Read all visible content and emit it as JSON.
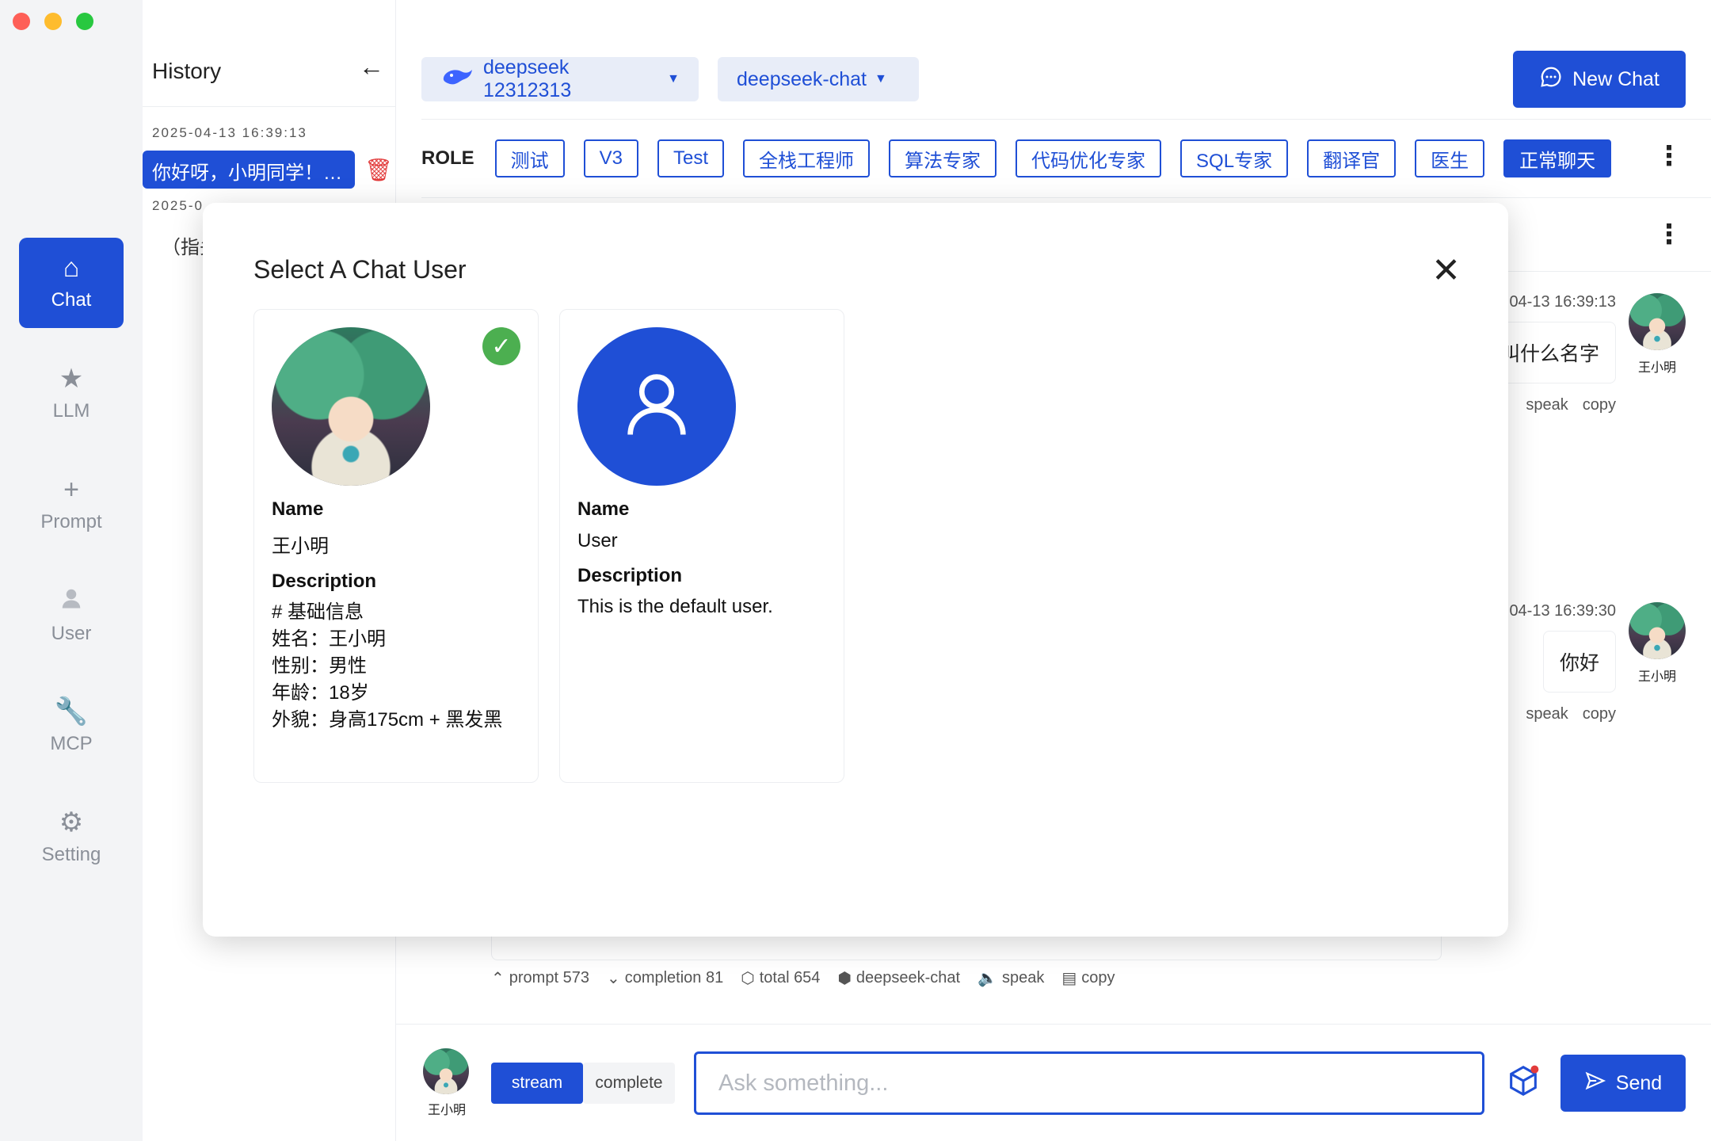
{
  "nav": {
    "items": [
      {
        "label": "Chat",
        "icon": "home-icon",
        "active": true
      },
      {
        "label": "LLM",
        "icon": "star-icon",
        "active": false
      },
      {
        "label": "Prompt",
        "icon": "plus-icon",
        "active": false
      },
      {
        "label": "User",
        "icon": "user-icon",
        "active": false
      },
      {
        "label": "MCP",
        "icon": "wrench-icon",
        "active": false
      },
      {
        "label": "Setting",
        "icon": "gear-icon",
        "active": false
      }
    ]
  },
  "history": {
    "title": "History",
    "entries": [
      {
        "timestamp": "2025-04-13 16:39:13",
        "text": "你好呀，小明同学！…"
      },
      {
        "timestamp": "2025-0",
        "text": "（指头"
      }
    ]
  },
  "topbar": {
    "provider": "deepseek 12312313",
    "model": "deepseek-chat",
    "new_chat": "New Chat"
  },
  "roles": {
    "label": "ROLE",
    "items": [
      "测试",
      "V3",
      "Test",
      "全栈工程师",
      "算法专家",
      "代码优化专家",
      "SQL专家",
      "翻译官",
      "医生",
      "正常聊天"
    ],
    "active": "正常聊天"
  },
  "messages": [
    {
      "meta": "04-13 16:39:13",
      "text": "叫什么名字",
      "user": "王小明",
      "actions": [
        "speak",
        "copy"
      ]
    },
    {
      "meta": "04-13 16:39:30",
      "text": "你好",
      "user": "王小明",
      "actions": [
        "speak",
        "copy"
      ]
    }
  ],
  "usage": {
    "prompt": "prompt 573",
    "completion": "completion 81",
    "total": "total 654",
    "model": "deepseek-chat",
    "speak": "speak",
    "copy": "copy"
  },
  "composer": {
    "user_name": "王小明",
    "mode_stream": "stream",
    "mode_complete": "complete",
    "placeholder": "Ask something...",
    "send": "Send"
  },
  "modal": {
    "title": "Select A Chat User",
    "users": [
      {
        "name_label": "Name",
        "name": "王小明",
        "desc_label": "Description",
        "description": "# 基础信息\n姓名：王小明\n性别：男性\n年龄：18岁\n外貌：身高175cm + 黑发黑",
        "selected": true
      },
      {
        "name_label": "Name",
        "name": "User",
        "desc_label": "Description",
        "description": "This is the default user.",
        "selected": false
      }
    ]
  },
  "colors": {
    "accent": "#1f4fd6",
    "danger": "#e23b3b",
    "success": "#4caf50"
  }
}
